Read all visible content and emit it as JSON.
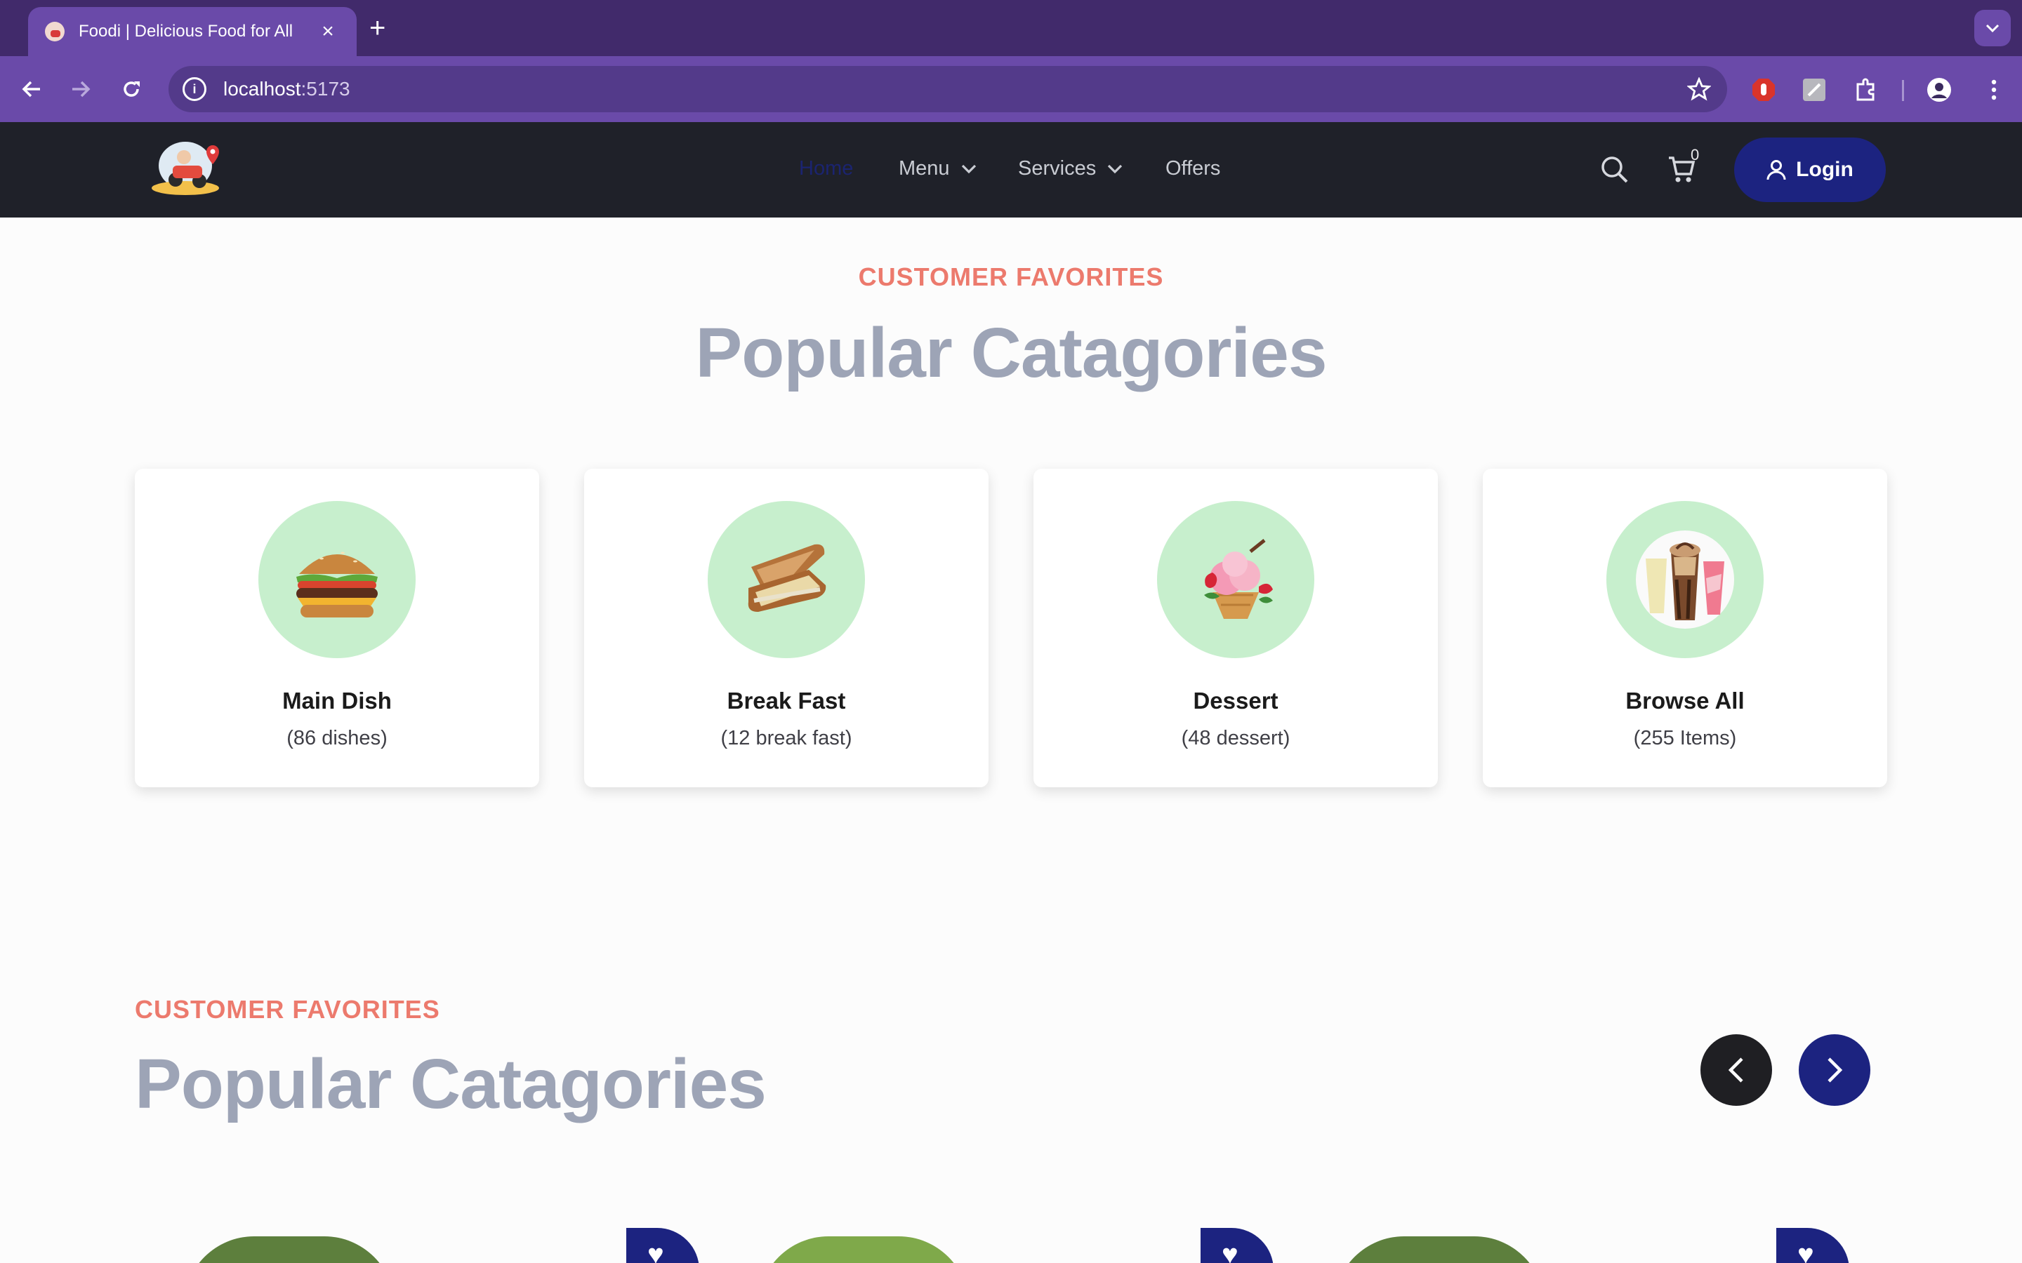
{
  "browser": {
    "tab_title": "Foodi | Delicious Food for All",
    "url_host": "localhost",
    "url_port": ":5173"
  },
  "header": {
    "nav": [
      {
        "label": "Home",
        "active": true
      },
      {
        "label": "Menu",
        "dropdown": true
      },
      {
        "label": "Services",
        "dropdown": true
      },
      {
        "label": "Offers"
      }
    ],
    "cart_count": "0",
    "login_label": "Login"
  },
  "section1": {
    "eyebrow": "CUSTOMER FAVORITES",
    "title": "Popular Catagories",
    "categories": [
      {
        "name": "Main Dish",
        "count": "(86 dishes)",
        "icon": "burger-icon"
      },
      {
        "name": "Break Fast",
        "count": "(12 break fast)",
        "icon": "sandwich-icon"
      },
      {
        "name": "Dessert",
        "count": "(48 dessert)",
        "icon": "ice-cream-icon"
      },
      {
        "name": "Browse All",
        "count": "(255 Items)",
        "icon": "drinks-icon"
      }
    ]
  },
  "section2": {
    "eyebrow": "CUSTOMER FAVORITES",
    "title": "Popular Catagories"
  },
  "colors": {
    "browser_tab_bar": "#412a6b",
    "browser_toolbar": "#6a4aa9",
    "site_header": "#1f2129",
    "accent_navy": "#1c2380",
    "eyebrow_coral": "#ec7a6d",
    "title_gray": "#9da4b6",
    "category_circle": "#c7efcd"
  }
}
